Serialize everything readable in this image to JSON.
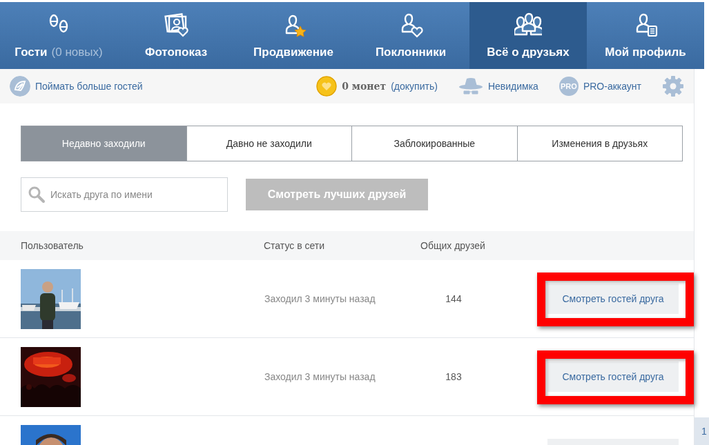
{
  "nav": [
    {
      "label": "Гости",
      "extra": "(0 новых)",
      "selected": false
    },
    {
      "label": "Фотопоказ",
      "selected": false
    },
    {
      "label": "Продвижение",
      "selected": false
    },
    {
      "label": "Поклонники",
      "selected": false
    },
    {
      "label": "Всё о друзьях",
      "selected": true
    },
    {
      "label": "Мой профиль",
      "selected": false
    }
  ],
  "toolbar": {
    "catch": "Поймать больше гостей",
    "coins": "0 монет",
    "buy": "(докупить)",
    "invisible": "Невидимка",
    "pro_badge": "PRO",
    "pro": "PRO-аккаунт"
  },
  "filter_tabs": [
    {
      "label": "Недавно заходили",
      "selected": true
    },
    {
      "label": "Давно не заходили",
      "selected": false
    },
    {
      "label": "Заблокированные",
      "selected": false
    },
    {
      "label": "Изменения в друзьях",
      "selected": false
    }
  ],
  "search": {
    "placeholder": "Искать друга по имени"
  },
  "best_button": "Смотреть лучших друзей",
  "table": {
    "columns": [
      "Пользователь",
      "Статус в сети",
      "Общих друзей"
    ],
    "rows": [
      {
        "kind": "full",
        "status": "Заходил 3 минуты назад",
        "mutual": "144",
        "button": "Смотреть гостей друга",
        "highlighted": true
      },
      {
        "kind": "full",
        "status": "Заходил 3 минуты назад",
        "mutual": "183",
        "button": "Смотреть гостей друга",
        "highlighted": true
      },
      {
        "kind": "partial",
        "highlighted": false
      }
    ]
  },
  "page_tab": "1"
}
